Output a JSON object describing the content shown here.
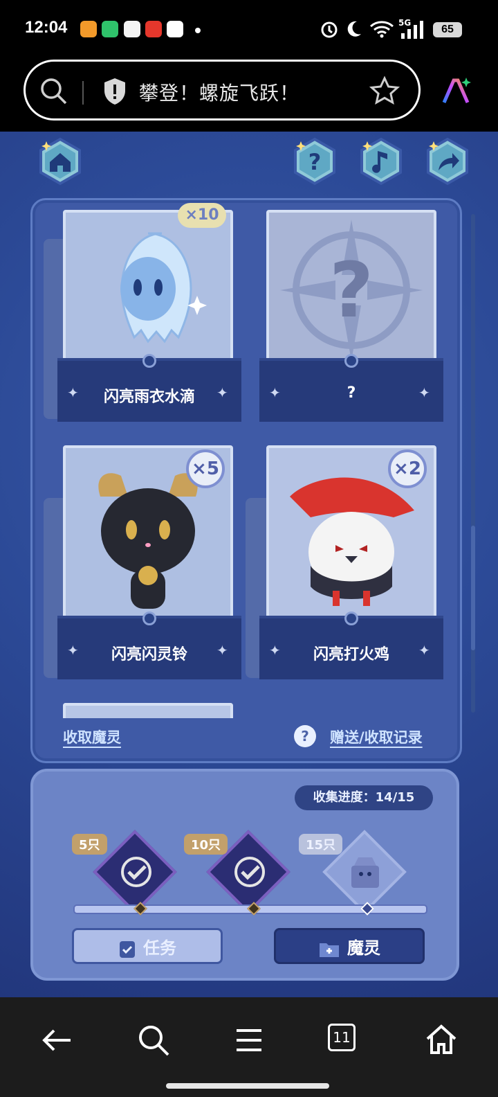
{
  "status_bar": {
    "time": "12:04",
    "battery": "65",
    "network": "5G"
  },
  "browser": {
    "page_title": "攀登！螺旋飞跃！"
  },
  "game": {
    "cards": [
      {
        "name": "闪亮雨衣水滴",
        "count": "×10"
      },
      {
        "name": "?",
        "count": ""
      },
      {
        "name": "闪亮闪灵铃",
        "count": "×5"
      },
      {
        "name": "闪亮打火鸡",
        "count": "×2"
      }
    ],
    "collect_link": "收取魔灵",
    "help_symbol": "?",
    "records_link": "赠送/收取记录",
    "progress_label": "收集进度：",
    "progress_value": "14/15",
    "milestones": [
      {
        "label": "5只",
        "done": true
      },
      {
        "label": "10只",
        "done": true
      },
      {
        "label": "15只",
        "done": false
      }
    ],
    "tab_task": "任务",
    "tab_spirit": "魔灵"
  },
  "nav": {
    "tabs_count": "11"
  },
  "colors": {
    "game_bg": "#2c4a97",
    "panel": "#3f5aa6",
    "plate": "#263a7a",
    "link": "#cfe3ff"
  }
}
